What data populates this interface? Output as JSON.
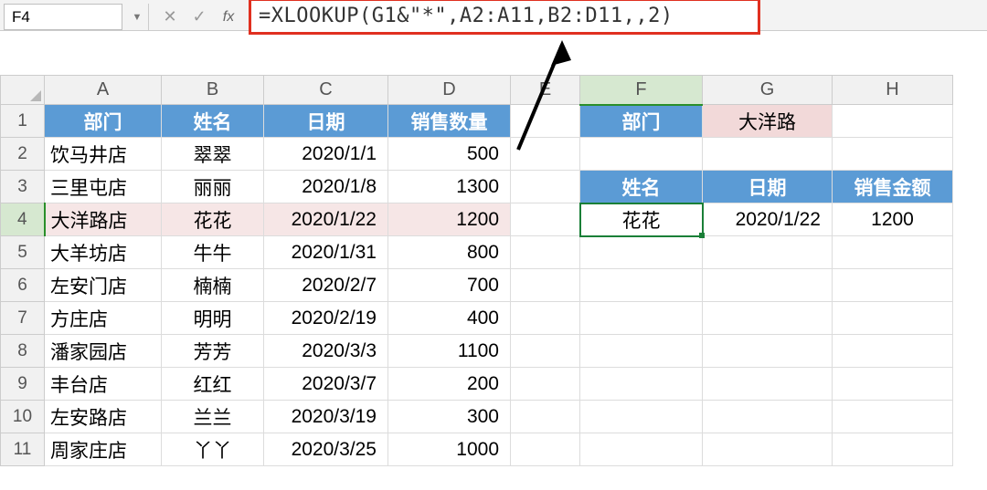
{
  "formula_bar": {
    "cell_ref": "F4",
    "formula": "=XLOOKUP(G1&\"*\",A2:A11,B2:D11,,2)"
  },
  "columns": [
    "A",
    "B",
    "C",
    "D",
    "E",
    "F",
    "G",
    "H"
  ],
  "rows": [
    "1",
    "2",
    "3",
    "4",
    "5",
    "6",
    "7",
    "8",
    "9",
    "10",
    "11"
  ],
  "col_widths": {
    "A": 128,
    "B": 112,
    "C": 136,
    "D": 134,
    "E": 76,
    "F": 134,
    "G": 142,
    "H": 132
  },
  "main_headers": {
    "dept": "部门",
    "name": "姓名",
    "date": "日期",
    "qty": "销售数量"
  },
  "main_rows": [
    {
      "dept": "饮马井店",
      "name": "翠翠",
      "date": "2020/1/1",
      "qty": "500"
    },
    {
      "dept": "三里屯店",
      "name": "丽丽",
      "date": "2020/1/8",
      "qty": "1300"
    },
    {
      "dept": "大洋路店",
      "name": "花花",
      "date": "2020/1/22",
      "qty": "1200"
    },
    {
      "dept": "大羊坊店",
      "name": "牛牛",
      "date": "2020/1/31",
      "qty": "800"
    },
    {
      "dept": "左安门店",
      "name": "楠楠",
      "date": "2020/2/7",
      "qty": "700"
    },
    {
      "dept": "方庄店",
      "name": "明明",
      "date": "2020/2/19",
      "qty": "400"
    },
    {
      "dept": "潘家园店",
      "name": "芳芳",
      "date": "2020/3/3",
      "qty": "1100"
    },
    {
      "dept": "丰台店",
      "name": "红红",
      "date": "2020/3/7",
      "qty": "200"
    },
    {
      "dept": "左安路店",
      "name": "兰兰",
      "date": "2020/3/19",
      "qty": "300"
    },
    {
      "dept": "周家庄店",
      "name": "丫丫",
      "date": "2020/3/25",
      "qty": "1000"
    }
  ],
  "lookup": {
    "label_dept": "部门",
    "search_value": "大洋路",
    "hdr_name": "姓名",
    "hdr_date": "日期",
    "hdr_amt": "销售金额",
    "res_name": "花花",
    "res_date": "2020/1/22",
    "res_amt": "1200"
  },
  "highlight_row_index": 2,
  "active_cell": "F4"
}
